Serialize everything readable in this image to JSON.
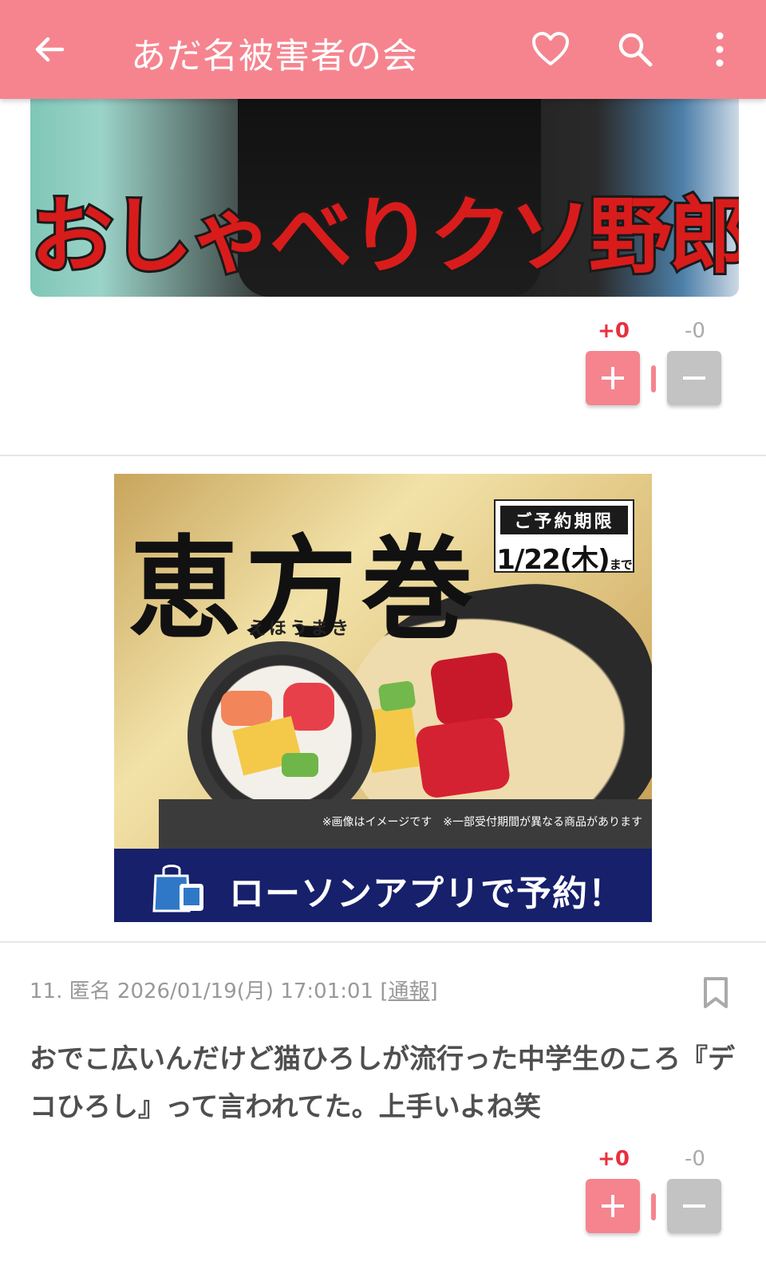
{
  "app_bar": {
    "title": "あだ名被害者の会",
    "back_icon": "arrow-left-icon",
    "favorite_icon": "heart-outline-icon",
    "search_icon": "search-icon",
    "more_icon": "more-vertical-icon",
    "background_color": "#f5848f"
  },
  "post_image": {
    "caption": "おしゃべりクソ野郎!!"
  },
  "votes_1": {
    "plus": "+0",
    "minus": "-0"
  },
  "ad": {
    "brand": "恵方巻",
    "reading": "えほうまき",
    "deadline_title": "ご予約期限",
    "deadline_date": "1/22(木)",
    "deadline_suffix": "まで",
    "note": "※画像はイメージです　※一部受付期間が異なる商品があります",
    "cta": "ローソンアプリで予約！",
    "bag_icon": "shopping-bag-icon",
    "banner_color": "#16206b"
  },
  "comment": {
    "number": "11.",
    "author": "匿名",
    "datetime": "2026/01/19(月) 17:01:01",
    "report_label": "通報",
    "bookmark_icon": "bookmark-icon",
    "body": "おでこ広いんだけど猫ひろしが流行った中学生のころ『デコひろし』って言われてた。上手いよね笑"
  },
  "votes_2": {
    "plus": "+0",
    "minus": "-0"
  },
  "accent_color": "#e8303f"
}
